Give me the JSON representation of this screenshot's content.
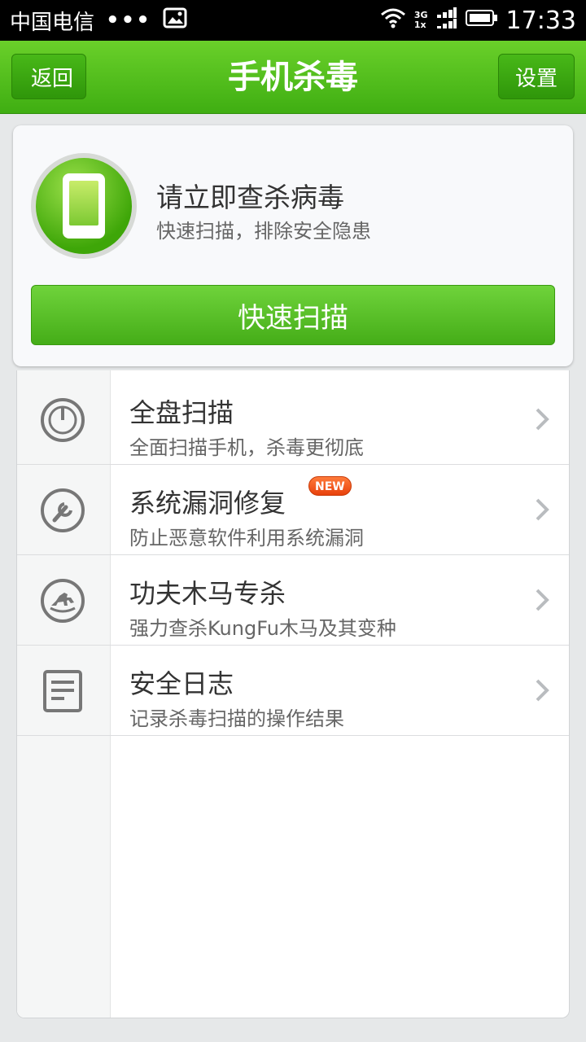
{
  "statusbar": {
    "carrier": "中国电信",
    "dots": "•••",
    "network_top": "3G",
    "network_bottom": "1x",
    "time": "17:33"
  },
  "header": {
    "back_label": "返回",
    "title": "手机杀毒",
    "settings_label": "设置"
  },
  "scan_card": {
    "title": "请立即查杀病毒",
    "subtitle": "快速扫描，排除安全隐患",
    "button_label": "快速扫描"
  },
  "menu": {
    "items": [
      {
        "title": "全盘扫描",
        "subtitle": "全面扫描手机，杀毒更彻底",
        "icon": "power-scan-icon"
      },
      {
        "title": "系统漏洞修复",
        "subtitle": "防止恶意软件利用系统漏洞",
        "icon": "wrench-icon",
        "badge": "NEW"
      },
      {
        "title": "功夫木马专杀",
        "subtitle": "强力查杀KungFu木马及其变种",
        "icon": "rocking-horse-icon"
      },
      {
        "title": "安全日志",
        "subtitle": "记录杀毒扫描的操作结果",
        "icon": "document-icon"
      }
    ]
  },
  "colors": {
    "brand_green": "#4cbb17",
    "badge_orange": "#e8410c"
  }
}
